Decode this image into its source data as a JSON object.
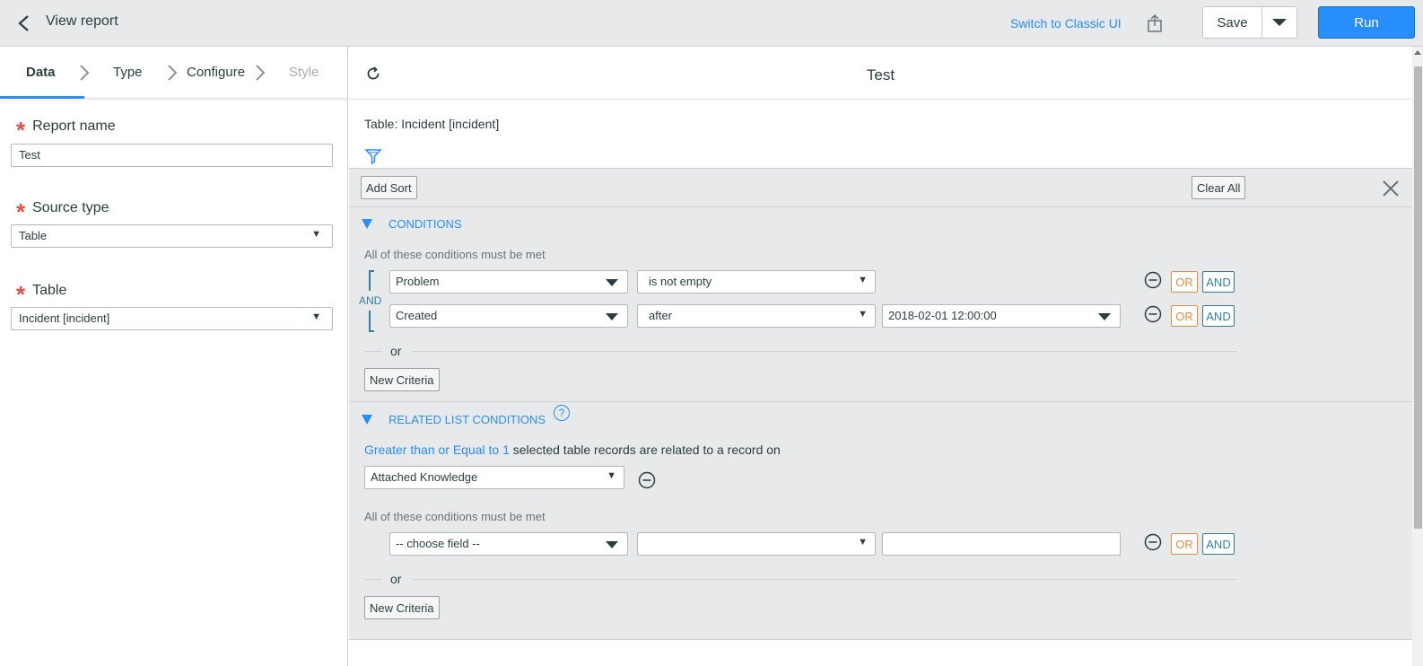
{
  "header": {
    "back_label": "View report",
    "switch_link": "Switch to Classic UI",
    "save_label": "Save",
    "run_label": "Run"
  },
  "steps": [
    {
      "label": "Data",
      "state": "active"
    },
    {
      "label": "Type",
      "state": "enabled"
    },
    {
      "label": "Configure",
      "state": "enabled"
    },
    {
      "label": "Style",
      "state": "disabled"
    }
  ],
  "form": {
    "report_name_label": "Report name",
    "report_name_value": "Test",
    "source_type_label": "Source type",
    "source_type_value": "Table",
    "table_label": "Table",
    "table_value": "Incident [incident]"
  },
  "report": {
    "title": "Test",
    "table_text": "Table: Incident [incident]"
  },
  "filter": {
    "add_sort": "Add Sort",
    "clear_all": "Clear All",
    "conditions_title": "CONDITIONS",
    "conditions_hint": "All of these conditions must be met",
    "and_label": "AND",
    "rows": [
      {
        "field": "Problem",
        "operator": "is not empty",
        "value": ""
      },
      {
        "field": "Created",
        "operator": "after",
        "value": "2018-02-01 12:00:00"
      }
    ],
    "or_label": "or",
    "or_btn": "OR",
    "and_btn": "AND",
    "new_criteria": "New Criteria",
    "related_title": "RELATED LIST CONDITIONS",
    "help_glyph": "?",
    "related_quantity_link": "Greater than or Equal to 1",
    "related_text": " selected table records are related to a record on",
    "related_list_value": "Attached Knowledge",
    "related_hint": "All of these conditions must be met",
    "related_field_placeholder": "-- choose field --",
    "related_or_label": "or",
    "related_new_criteria": "New Criteria"
  },
  "colors": {
    "accent": "#278efc",
    "required": "#e3504a",
    "or_orange": "#e88b3f",
    "and_teal": "#2f7fa4"
  }
}
